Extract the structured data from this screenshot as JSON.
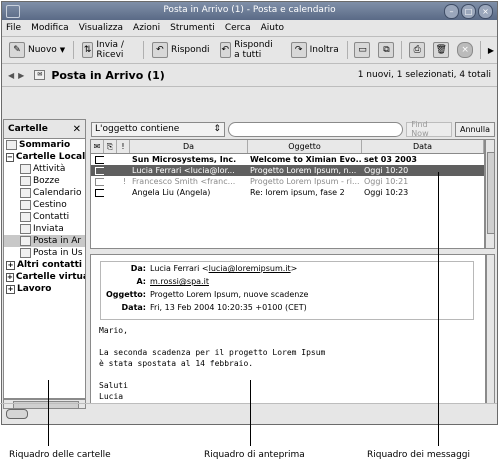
{
  "window": {
    "title": "Posta in Arrivo (1) - Posta e calendario"
  },
  "menu": [
    "File",
    "Modifica",
    "Visualizza",
    "Azioni",
    "Strumenti",
    "Cerca",
    "Aiuto"
  ],
  "toolbar": {
    "new_label": "Nuovo",
    "sendrecv_label": "Invia / Ricevi",
    "reply_label": "Rispondi",
    "replyall_label": "Rispondi a tutti",
    "forward_label": "Inoltra"
  },
  "folderbar": {
    "name": "Posta in Arrivo (1)",
    "status": "1 nuovi, 1 selezionati, 4 totali"
  },
  "sidebar": {
    "header": "Cartelle",
    "close": "✕",
    "items": [
      {
        "label": "Sommario"
      },
      {
        "label": "Cartelle Locali"
      },
      {
        "label": "Attività"
      },
      {
        "label": "Bozze"
      },
      {
        "label": "Calendario"
      },
      {
        "label": "Cestino"
      },
      {
        "label": "Contatti"
      },
      {
        "label": "Inviata"
      },
      {
        "label": "Posta in Ar"
      },
      {
        "label": "Posta in Us"
      },
      {
        "label": "Altri contatti"
      },
      {
        "label": "Cartelle virtuali"
      },
      {
        "label": "Lavoro"
      }
    ]
  },
  "search": {
    "filter": "L'oggetto contiene",
    "value": "",
    "find_now": "Find Now",
    "clear": "Annulla"
  },
  "columns": {
    "from": "Da",
    "subject": "Oggetto",
    "date": "Data"
  },
  "messages": [
    {
      "flag": "",
      "from": "Sun Microsystems, Inc.",
      "subject": "Welcome to Ximian Evo...",
      "date": "set 03 2003"
    },
    {
      "flag": "",
      "from": "Lucia Ferrari <lucia@lor...",
      "subject": "Progetto Lorem Ipsum, n...",
      "date": "Oggi 10:20"
    },
    {
      "flag": "!",
      "from": "Francesco Smith <franc...",
      "subject": "Progetto Lorem Ipsum - ri...",
      "date": "Oggi 10:21"
    },
    {
      "flag": "",
      "from": "Angela Liu (Angela)",
      "subject": "Re: lorem ipsum, fase 2",
      "date": "Oggi 10:23"
    }
  ],
  "preview": {
    "from_key": "Da:",
    "from_name": "Lucia Ferrari <",
    "from_email": "lucia@loremipsum.it",
    "from_end": ">",
    "to_key": "A:",
    "to": "m.rossi@spa.it",
    "subject_key": "Oggetto:",
    "subject": "Progetto Lorem Ipsum, nuove scadenze",
    "date_key": "Data:",
    "date": "Fri, 13 Feb 2004 10:20:35 +0100 (CET)",
    "body": "Mario,\n\nLa seconda scadenza per il progetto Lorem Ipsum\nè stata spostata al 14 febbraio.\n\nSaluti\nLucia"
  },
  "callouts": {
    "folders": "Riquadro delle cartelle",
    "preview": "Riquadro di anteprima",
    "messages": "Riquadro dei messaggi"
  }
}
